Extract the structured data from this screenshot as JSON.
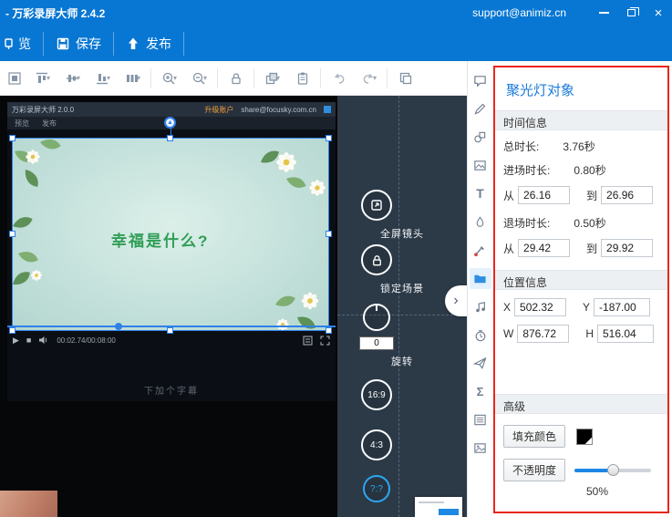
{
  "window": {
    "title": "- 万彩录屏大师 2.4.2",
    "support_email": "support@animiz.cn"
  },
  "ribbon": {
    "preview_label": "览",
    "save_label": "保存",
    "publish_label": "发布"
  },
  "toolbar_icons": [
    "align-canvas-icon",
    "align-top-icon",
    "align-middle-icon",
    "align-bottom-icon",
    "distribute-icon",
    "zoom-in-icon",
    "zoom-out-icon",
    "lock-icon",
    "arrange-order-icon",
    "clipboard-icon",
    "undo-icon",
    "redo-icon",
    "layers-icon"
  ],
  "sidebar_icons": [
    "callout-icon",
    "pencil-icon",
    "shapes-icon",
    "frame-icon",
    "text-icon",
    "droplet-icon",
    "brush-icon",
    "folder-icon",
    "music-icon",
    "timer-icon",
    "plane-icon",
    "formula-icon",
    "list-icon",
    "photo-icon"
  ],
  "stage": {
    "fullscreen_label": "全屏镜头",
    "lock_label": "锁定场景",
    "rotate_value": "0",
    "rotate_label": "旋转",
    "ratio_16_9": "16:9",
    "ratio_4_3": "4:3",
    "ratio_custom": "?:?",
    "collapse_glyph": "›"
  },
  "preview": {
    "app_title": "万彩录屏大师 2.0.0",
    "upgrade_label": "升级账户",
    "account_email": "share@focusky.com.cn",
    "menu_preview": "预览",
    "menu_publish": "发布",
    "slide_text": "幸福是什么?",
    "time_display": "00:02.74/00:08:00",
    "subtitle_hint": "下加个字幕"
  },
  "panel": {
    "title": "聚光灯对象",
    "time": {
      "header": "时间信息",
      "total_label": "总时长:",
      "total_value": "3.76秒",
      "in_label": "进场时长:",
      "in_value": "0.80秒",
      "from_label": "从",
      "to_label": "到",
      "in_from": "26.16",
      "in_to": "26.96",
      "out_label": "退场时长:",
      "out_value": "0.50秒",
      "out_from": "29.42",
      "out_to": "29.92"
    },
    "position": {
      "header": "位置信息",
      "x_label": "X",
      "x_value": "502.32",
      "y_label": "Y",
      "y_value": "-187.00",
      "w_label": "W",
      "w_value": "876.72",
      "h_label": "H",
      "h_value": "516.04"
    },
    "advanced": {
      "header": "高级",
      "fill_label": "填充颜色",
      "opacity_label": "不透明度",
      "opacity_percent": "50%"
    }
  },
  "colors": {
    "titlebar_blue": "#0877d3",
    "accent_blue": "#2aa7f2",
    "selection_blue": "#2f80e8",
    "highlight_red": "#e8261d",
    "stage_bg": "#2c3a48"
  }
}
